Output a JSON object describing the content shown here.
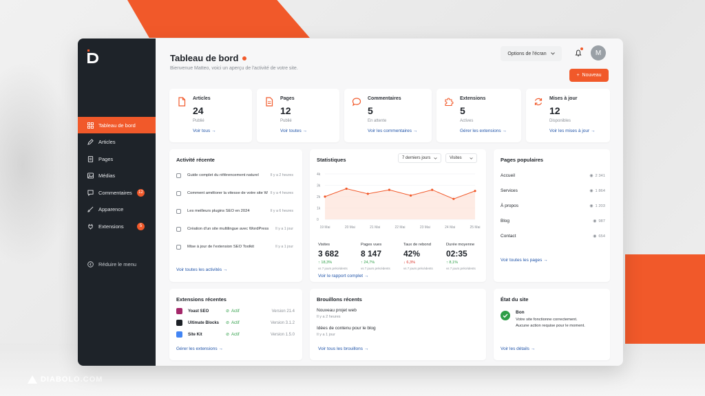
{
  "brand": {
    "name": "DIABOLO.COM"
  },
  "sidebar": {
    "items": [
      {
        "label": "Tableau de bord",
        "icon": "dashboard-icon",
        "active": true
      },
      {
        "label": "Articles",
        "icon": "edit-icon"
      },
      {
        "label": "Pages",
        "icon": "page-icon"
      },
      {
        "label": "Médias",
        "icon": "media-icon"
      },
      {
        "label": "Commentaires",
        "icon": "comment-icon",
        "badge": "12"
      },
      {
        "label": "Apparence",
        "icon": "brush-icon"
      },
      {
        "label": "Extensions",
        "icon": "plugin-icon",
        "badge": "5"
      }
    ],
    "collapse_label": "Réduire le menu"
  },
  "header": {
    "title": "Tableau de bord",
    "subtitle": "Bienvenue Matteo, voici un aperçu de l'activité de votre site.",
    "screen_options": "Options de l'écran",
    "avatar_letter": "M",
    "new_button": "Nouveau"
  },
  "stats": [
    {
      "label": "Articles",
      "value": "24",
      "sub": "Publié",
      "link": "Voir tous",
      "icon": "document-icon"
    },
    {
      "label": "Pages",
      "value": "12",
      "sub": "Publié",
      "link": "Voir toutes",
      "icon": "page-icon"
    },
    {
      "label": "Commentaires",
      "value": "5",
      "sub": "En attente",
      "link": "Voir les commentaires",
      "icon": "comment-icon"
    },
    {
      "label": "Extensions",
      "value": "5",
      "sub": "Actives",
      "link": "Gérer les extensions",
      "icon": "puzzle-icon"
    },
    {
      "label": "Mises à jour",
      "value": "12",
      "sub": "Disponibles",
      "link": "Voir les mises à jour",
      "icon": "refresh-icon"
    }
  ],
  "activity": {
    "title": "Activité récente",
    "items": [
      {
        "text": "Guide complet du référencement naturel",
        "time": "Il y a 2 heures"
      },
      {
        "text": "Comment améliorer la vitesse de votre site WordPress",
        "time": "Il y a 4 heures"
      },
      {
        "text": "Les meilleurs plugins SEO en 2024",
        "time": "Il y a 6 heures"
      },
      {
        "text": "Création d'un site multilingue avec WordPress",
        "time": "Il y a 1 jour"
      },
      {
        "text": "Mise à jour de l'extension SEO Toolkit",
        "time": "Il y a 1 jour"
      }
    ],
    "link": "Voir toutes les activités"
  },
  "statistics": {
    "title": "Statistiques",
    "range": "7 derniers jours",
    "metric_select": "Visites",
    "metrics": [
      {
        "label": "Visites",
        "value": "3 682",
        "delta": "18,3%",
        "up": true,
        "cmp": "vs 7 jours précédents"
      },
      {
        "label": "Pages vues",
        "value": "8 147",
        "delta": "24,7%",
        "up": true,
        "cmp": "vs 7 jours précédents"
      },
      {
        "label": "Taux de rebond",
        "value": "42%",
        "delta": "6,3%",
        "up": false,
        "cmp": "vs 7 jours précédents"
      },
      {
        "label": "Durée moyenne",
        "value": "02:35",
        "delta": "8,1%",
        "up": true,
        "cmp": "vs 7 jours précédents"
      }
    ],
    "link": "Voir le rapport complet"
  },
  "chart_data": {
    "type": "area",
    "categories": [
      "19 Mai",
      "20 Mai",
      "21 Mai",
      "22 Mai",
      "23 Mai",
      "24 Mai",
      "25 Mai"
    ],
    "series": [
      {
        "values": [
          2000,
          2700,
          2250,
          2600,
          2100,
          2600,
          1800,
          2500
        ]
      }
    ],
    "x_points": [
      "19 Mai",
      "20 Mai",
      "21 Mai",
      "22 Mai",
      "23 Mai",
      "24 Mai",
      "24.5",
      "25 Mai"
    ],
    "y_ticks": [
      "4k",
      "3k",
      "2k",
      "1k",
      "0"
    ],
    "ylim": [
      0,
      4000
    ],
    "grid": true,
    "colors": {
      "line": "#f1592a",
      "fill": "#fde3d8"
    }
  },
  "popular": {
    "title": "Pages populaires",
    "items": [
      {
        "name": "Accueil",
        "views": "2 341"
      },
      {
        "name": "Services",
        "views": "1 864"
      },
      {
        "name": "À propos",
        "views": "1 203"
      },
      {
        "name": "Blog",
        "views": "987"
      },
      {
        "name": "Contact",
        "views": "654"
      }
    ],
    "link": "Voir toutes les pages"
  },
  "extensions": {
    "title": "Extensions récentes",
    "items": [
      {
        "name": "Yoast SEO",
        "status": "Actif",
        "version": "Version 21.4",
        "color": "#a4286a"
      },
      {
        "name": "Ultimate Blocks",
        "status": "Actif",
        "version": "Version 3.1.2",
        "color": "#1d2127"
      },
      {
        "name": "Site Kit",
        "status": "Actif",
        "version": "Version 1.5.0",
        "color": "#4285f4"
      }
    ],
    "link": "Gérer les extensions"
  },
  "drafts": {
    "title": "Brouillons récents",
    "items": [
      {
        "title": "Nouveau projet web",
        "time": "Il y a 2 heures"
      },
      {
        "title": "Idées de contenu pour le blog",
        "time": "Il y a 1 jour"
      }
    ],
    "link": "Voir tous les brouillons"
  },
  "site_status": {
    "title": "État du site",
    "status": "Bon",
    "line1": "Votre site fonctionne correctement.",
    "line2": "Aucune action requise pour le moment.",
    "link": "Voir les détails"
  },
  "colors": {
    "accent": "#f1592a",
    "sidebar": "#1e2329",
    "link": "#1f53a8",
    "success": "#2e9e47",
    "danger": "#d9342b"
  }
}
